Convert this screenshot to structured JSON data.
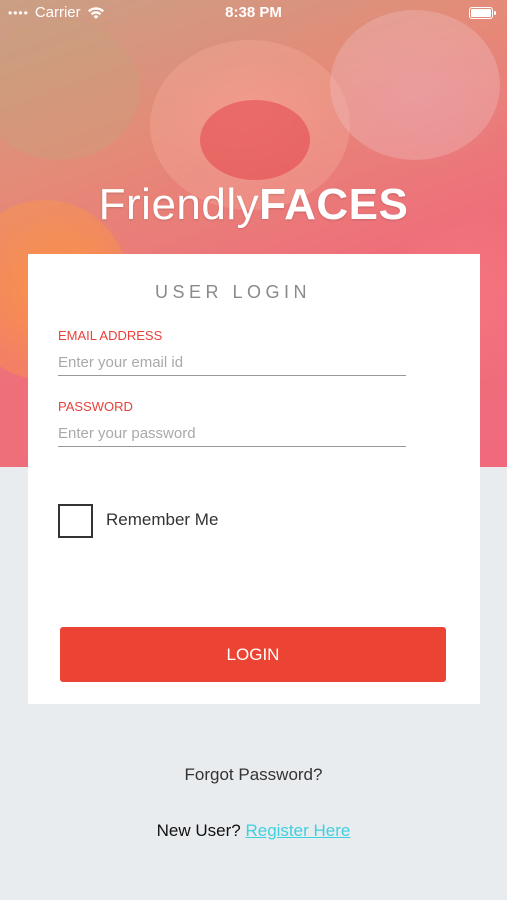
{
  "status_bar": {
    "carrier": "Carrier",
    "time": "8:38 PM",
    "signal_icon": "signal-dots-icon",
    "wifi_icon": "wifi-icon",
    "battery_icon": "battery-icon"
  },
  "branding": {
    "logo_light": "Friendly",
    "logo_bold": "FACES"
  },
  "login_card": {
    "title": "USER LOGIN",
    "email": {
      "label": "EMAIL ADDRESS",
      "placeholder": "Enter your email id",
      "value": ""
    },
    "password": {
      "label": "PASSWORD",
      "placeholder": "Enter your password",
      "value": ""
    },
    "remember_me": {
      "label": "Remember Me",
      "checked": false
    },
    "login_button": "LOGIN"
  },
  "footer": {
    "forgot_password": "Forgot Password?",
    "new_user_prefix": "New User?",
    "register_link": "Register Here"
  },
  "colors": {
    "accent": "#ec4434",
    "label": "#e8413a",
    "link": "#3fd0e0",
    "background": "#e9ecef"
  }
}
